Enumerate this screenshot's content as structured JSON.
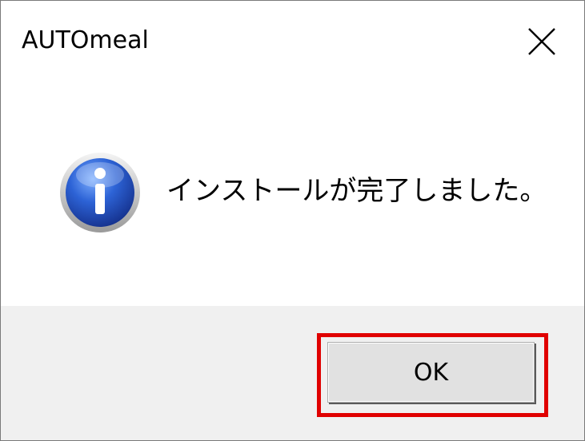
{
  "window": {
    "title": "AUTOmeal",
    "close_icon": "close-icon"
  },
  "dialog": {
    "icon": "info-icon",
    "message": "インストールが完了しました。"
  },
  "buttons": {
    "ok_label": "OK"
  },
  "colors": {
    "highlight": "#e00000",
    "footer_bg": "#f0f0f0",
    "icon_blue": "#1f4fb8"
  }
}
